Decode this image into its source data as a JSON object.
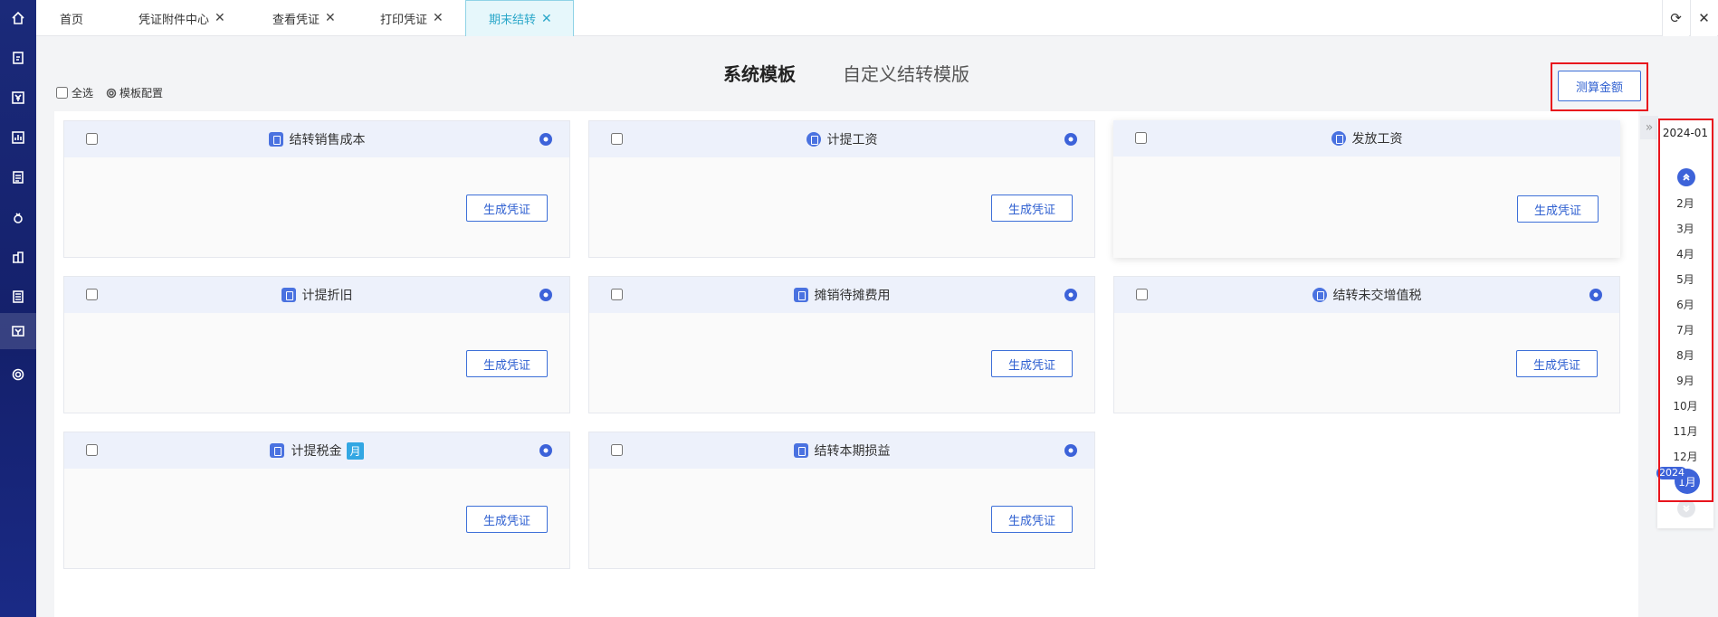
{
  "colors": {
    "primary": "#3d6fd8",
    "highlight": "#e8141d",
    "active_tab": "#2aa7c9",
    "nav": "#14206b"
  },
  "nav": {
    "icons": [
      "home-icon",
      "edit-doc-icon",
      "yen-icon",
      "report-icon",
      "ledger-icon",
      "money-bag-icon",
      "chart-building-icon",
      "receipt-icon",
      "voucher-icon",
      "settings-icon"
    ],
    "active_index": 8
  },
  "tabs": [
    {
      "label": "首页",
      "closable": false
    },
    {
      "label": "凭证附件中心",
      "closable": true
    },
    {
      "label": "查看凭证",
      "closable": true
    },
    {
      "label": "打印凭证",
      "closable": true
    },
    {
      "label": "期末结转",
      "closable": true,
      "active": true
    }
  ],
  "tab_close_glyph": "✕",
  "toolbar_icons": [
    "refresh-icon",
    "close-icon"
  ],
  "mode_tabs": {
    "system": "系统模板",
    "custom": "自定义结转模版"
  },
  "toolrow": {
    "select_all": "全选",
    "template_config": "模板配置"
  },
  "calc_button": "测算金额",
  "cards": [
    {
      "title": "结转销售成本",
      "icon": "house-doc-icon",
      "button": "生成凭证"
    },
    {
      "title": "计提工资",
      "icon": "money-bag-icon",
      "button": "生成凭证"
    },
    {
      "title": "发放工资",
      "icon": "wallet-icon",
      "button": "生成凭证"
    },
    {
      "title": "计提折旧",
      "icon": "depreciation-icon",
      "button": "生成凭证"
    },
    {
      "title": "摊销待摊费用",
      "icon": "amortize-icon",
      "button": "生成凭证"
    },
    {
      "title": "结转未交增值税",
      "icon": "tax-coins-icon",
      "button": "生成凭证"
    },
    {
      "title": "计提税金",
      "icon": "tax-doc-icon",
      "badge": "月",
      "button": "生成凭证"
    },
    {
      "title": "结转本期损益",
      "icon": "trend-chart-icon",
      "button": "生成凭证"
    }
  ],
  "period": {
    "collapse_glyph": "»",
    "year_label": "2024-01",
    "months": [
      "2月",
      "3月",
      "4月",
      "5月",
      "6月",
      "7月",
      "8月",
      "9月",
      "10月",
      "11月",
      "12月"
    ],
    "selected_month": "1月",
    "selected_year": "2024"
  }
}
